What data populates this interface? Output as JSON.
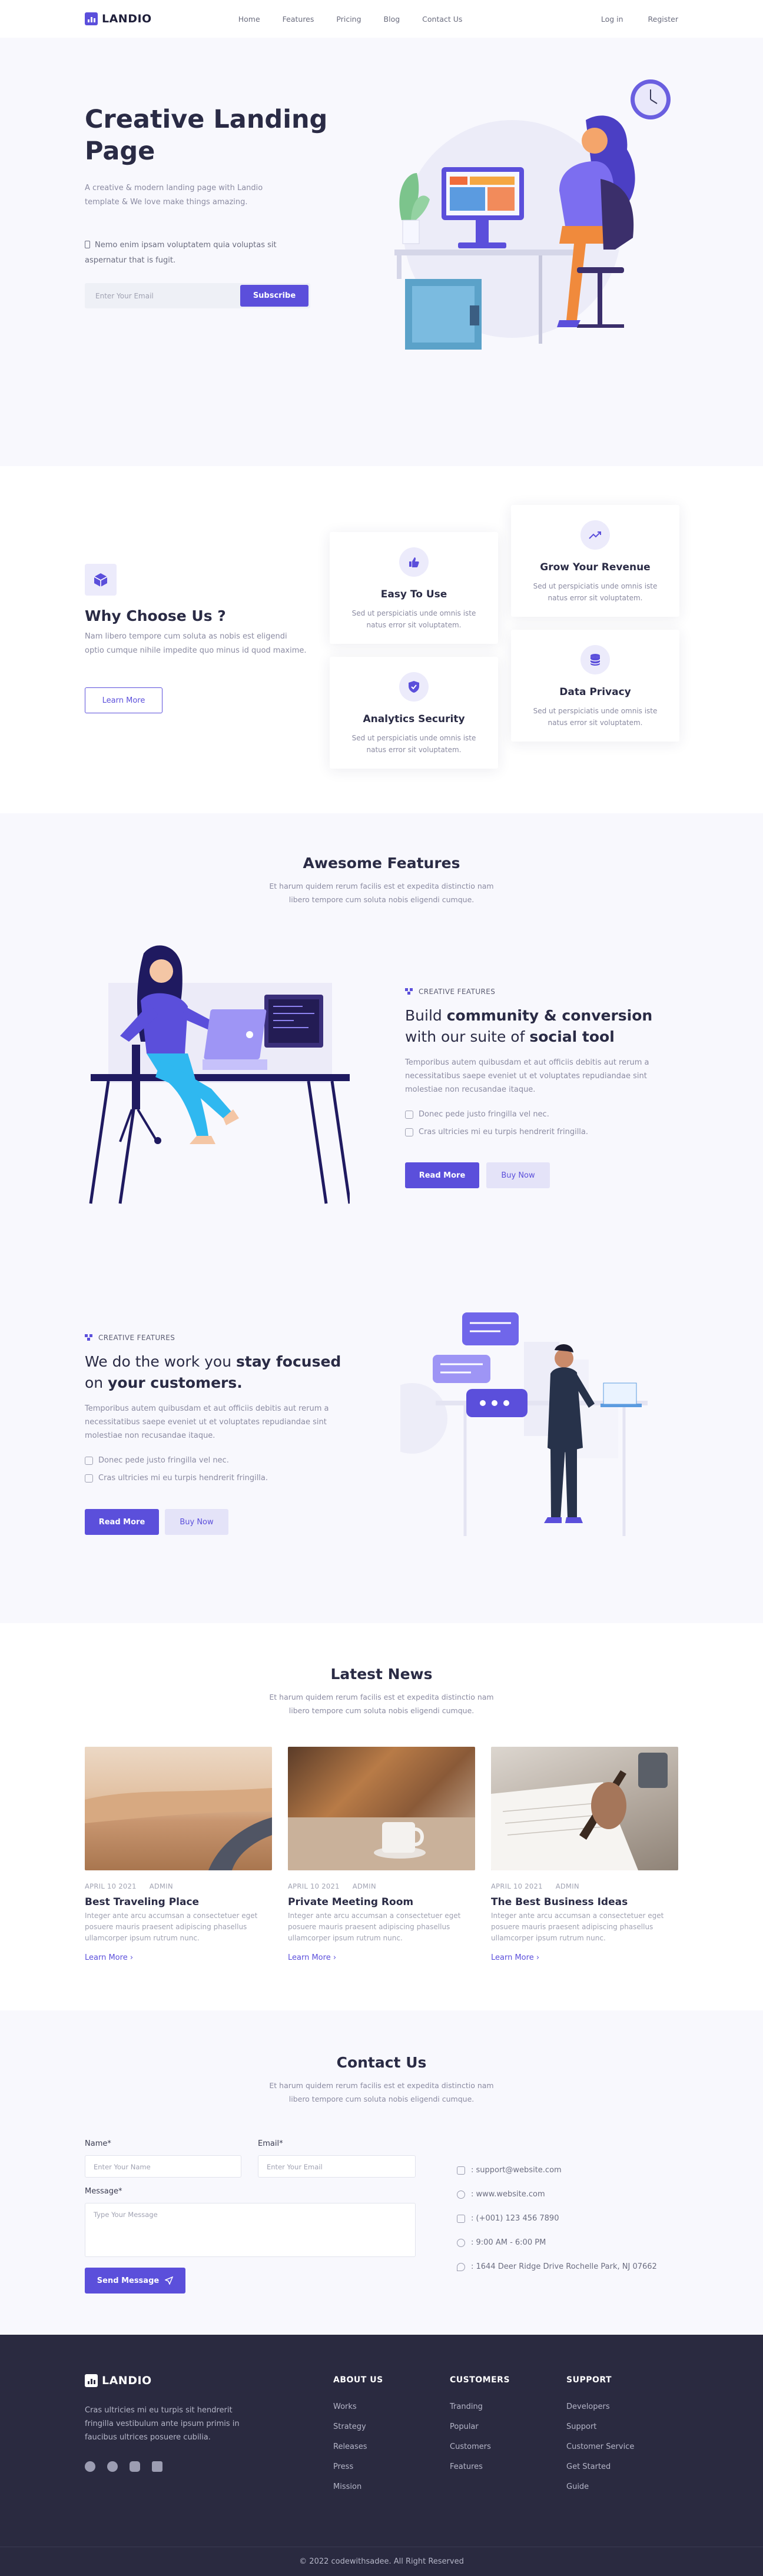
{
  "brand": {
    "name": "LANDIO",
    "accent": "#5b4fdb"
  },
  "nav": {
    "links": [
      "Home",
      "Features",
      "Pricing",
      "Blog",
      "Contact Us"
    ],
    "login": "Log in",
    "register": "Register"
  },
  "hero": {
    "title": "Creative Landing Page",
    "subtitle": "A creative & modern landing page with Landio template & We love make things amazing.",
    "note": "Nemo enim ipsam voluptatem quia voluptas sit aspernatur that is fugit.",
    "email_placeholder": "Enter Your Email",
    "subscribe": "Subscribe"
  },
  "why": {
    "title": "Why Choose Us ?",
    "text": "Nam libero tempore cum soluta as nobis est eligendi optio cumque nihile impedite quo minus id quod maxime.",
    "learn_more": "Learn More",
    "cards": [
      {
        "title": "Easy To Use",
        "text": "Sed ut perspiciatis unde omnis iste natus error sit voluptatem.",
        "icon": "thumbs-up-icon"
      },
      {
        "title": "Grow Your Revenue",
        "text": "Sed ut perspiciatis unde omnis iste natus error sit voluptatem.",
        "icon": "trending-up-icon"
      },
      {
        "title": "Analytics Security",
        "text": "Sed ut perspiciatis unde omnis iste natus error sit voluptatem.",
        "icon": "shield-icon"
      },
      {
        "title": "Data Privacy",
        "text": "Sed ut perspiciatis unde omnis iste natus error sit voluptatem.",
        "icon": "database-icon"
      }
    ]
  },
  "features": {
    "title": "Awesome Features",
    "subtitle": "Et harum quidem rerum facilis est et expedita distinctio nam libero tempore cum soluta nobis eligendi cumque.",
    "blocks": [
      {
        "tag": "CREATIVE FEATURES",
        "heading_pre": "Build ",
        "heading_b1": "community & conversion",
        "heading_mid": " with our suite of ",
        "heading_b2": "social tool",
        "heading_post": "",
        "text": "Temporibus autem quibusdam et aut officiis debitis aut rerum a necessitatibus saepe eveniet ut et voluptates repudiandae sint molestiae non recusandae itaque.",
        "item1": "Donec pede justo fringilla vel nec.",
        "item2": "Cras ultricies mi eu turpis hendrerit fringilla.",
        "read_more": "Read More",
        "buy_now": "Buy Now"
      },
      {
        "tag": "CREATIVE FEATURES",
        "heading_pre": "We do the work you ",
        "heading_b1": "stay focused",
        "heading_mid": " on ",
        "heading_b2": "your customers.",
        "heading_post": "",
        "text": "Temporibus autem quibusdam et aut officiis debitis aut rerum a necessitatibus saepe eveniet ut et voluptates repudiandae sint molestiae non recusandae itaque.",
        "item1": "Donec pede justo fringilla vel nec.",
        "item2": "Cras ultricies mi eu turpis hendrerit fringilla.",
        "read_more": "Read More",
        "buy_now": "Buy Now"
      }
    ]
  },
  "news": {
    "title": "Latest News",
    "subtitle": "Et harum quidem rerum facilis est et expedita distinctio nam libero tempore cum soluta nobis eligendi cumque.",
    "posts": [
      {
        "date": "APRIL 10 2021",
        "author": "ADMIN",
        "title": "Best Traveling Place",
        "text": "Integer ante arcu accumsan a consectetuer eget posuere mauris praesent adipiscing phasellus ullamcorper ipsum rutrum nunc.",
        "link": "Learn More"
      },
      {
        "date": "APRIL 10 2021",
        "author": "ADMIN",
        "title": "Private Meeting Room",
        "text": "Integer ante arcu accumsan a consectetuer eget posuere mauris praesent adipiscing phasellus ullamcorper ipsum rutrum nunc.",
        "link": "Learn More"
      },
      {
        "date": "APRIL 10 2021",
        "author": "ADMIN",
        "title": "The Best Business Ideas",
        "text": "Integer ante arcu accumsan a consectetuer eget posuere mauris praesent adipiscing phasellus ullamcorper ipsum rutrum nunc.",
        "link": "Learn More"
      }
    ]
  },
  "contact": {
    "title": "Contact Us",
    "subtitle": "Et harum quidem rerum facilis est et expedita distinctio nam libero tempore cum soluta nobis eligendi cumque.",
    "name_label": "Name*",
    "name_placeholder": "Enter Your Name",
    "email_label": "Email*",
    "email_placeholder": "Enter Your Email",
    "message_label": "Message*",
    "message_placeholder": "Type Your Message",
    "send": "Send Message",
    "info": [
      ": support@website.com",
      ": www.website.com",
      ": (+001) 123 456 7890",
      ": 9:00 AM - 6:00 PM",
      ": 1644 Deer Ridge Drive Rochelle Park, NJ 07662"
    ]
  },
  "footer": {
    "about": "Cras ultricies mi eu turpis sit hendrerit fringilla vestibulum ante ipsum primis in faucibus ultrices posuere cubilia.",
    "columns": [
      {
        "title": "ABOUT US",
        "links": [
          "Works",
          "Strategy",
          "Releases",
          "Press",
          "Mission"
        ]
      },
      {
        "title": "CUSTOMERS",
        "links": [
          "Tranding",
          "Popular",
          "Customers",
          "Features"
        ]
      },
      {
        "title": "SUPPORT",
        "links": [
          "Developers",
          "Support",
          "Customer Service",
          "Get Started",
          "Guide"
        ]
      }
    ],
    "copyright": "© 2022 codewithsadee. All Right Reserved"
  }
}
